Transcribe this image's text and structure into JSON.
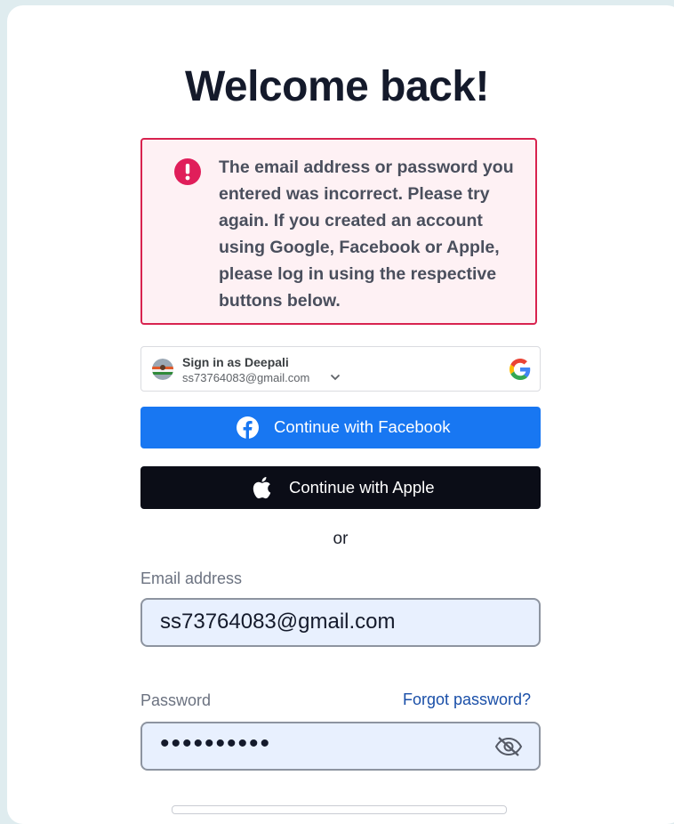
{
  "page": {
    "title": "Welcome back!"
  },
  "error": {
    "message": "The email address or password you entered was incorrect. Please try again. If you created an account using Google, Facebook or Apple, please log in using the respective buttons below."
  },
  "google_signin": {
    "name": "Sign in as Deepali",
    "email": "ss73764083@gmail.com",
    "icon": "google-g-logo"
  },
  "buttons": {
    "facebook": "Continue with Facebook",
    "apple": "Continue with Apple"
  },
  "divider": {
    "or": "or"
  },
  "form": {
    "email_label": "Email address",
    "email_value": "ss73764083@gmail.com",
    "password_label": "Password",
    "password_value": "••••••••••",
    "forgot_link": "Forgot password?"
  },
  "colors": {
    "error_border": "#d8234f",
    "error_bg": "#fef1f4",
    "facebook_blue": "#1877f2",
    "apple_black": "#0b0d17",
    "input_bg": "#e8f0fe",
    "link_blue": "#1a4fa8"
  }
}
